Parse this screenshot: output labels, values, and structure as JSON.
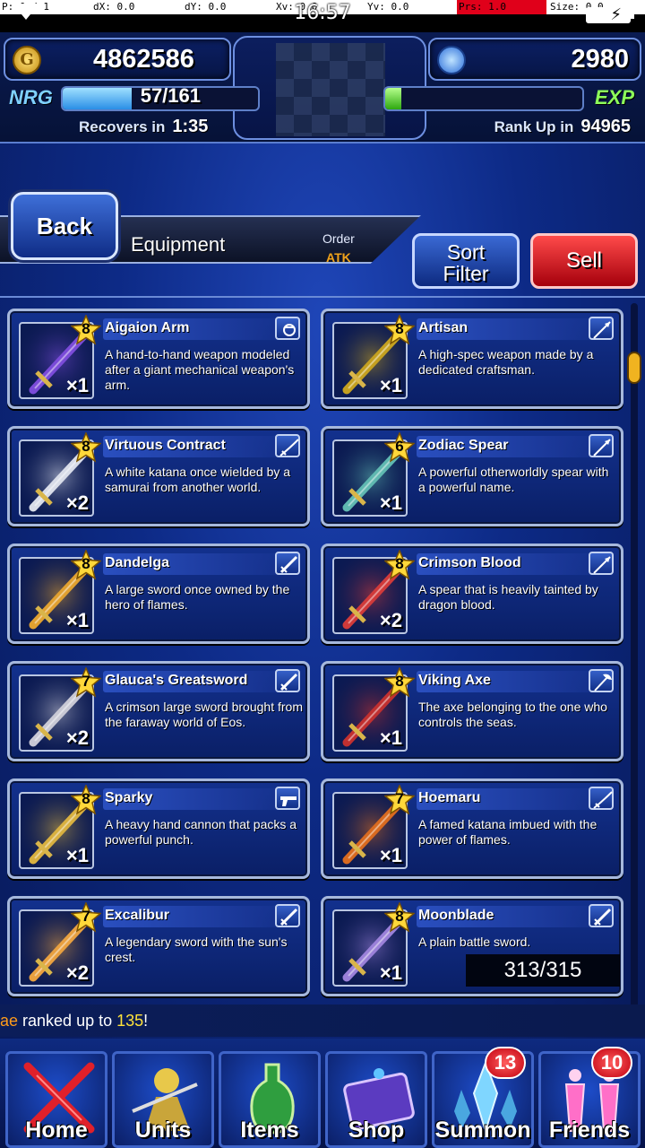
{
  "debug": {
    "p": "P: 0 / 1",
    "dx": "dX: 0.0",
    "dy": "dY: 0.0",
    "xv": "Xv: 0.0",
    "yv": "Yv: 0.0",
    "prs": "Prs: 1.0",
    "size": "Size: 0.0"
  },
  "status": {
    "time": "16:57",
    "battery_level": 1.0
  },
  "hud": {
    "gil": "4862586",
    "gems": "2980",
    "nrg_label": "NRG",
    "nrg_value": "57/161",
    "nrg_current": 57,
    "nrg_max": 161,
    "recovers_label": "Recovers in",
    "recovers_time": "1:35",
    "exp_label": "EXP",
    "exp_fraction": 0.08,
    "rank_label": "Rank Up in",
    "rank_value": "94965"
  },
  "header": {
    "back": "Back",
    "title": "Equipment",
    "order_label": "Order",
    "order_value": "ATK",
    "sort_line1": "Sort",
    "sort_line2": "Filter",
    "sell": "Sell"
  },
  "items": [
    {
      "name": "Aigaion Arm",
      "rarity": "8",
      "qty": "×1",
      "desc": "A hand-to-hand weapon modeled after a giant mechanical weapon's arm.",
      "type_icon": "fist-icon",
      "color": "#7a4bd8"
    },
    {
      "name": "Artisan",
      "rarity": "8",
      "qty": "×1",
      "desc": "A high-spec weapon made by a dedicated craftsman.",
      "type_icon": "spear-icon",
      "color": "#c4a020"
    },
    {
      "name": "Virtuous Contract",
      "rarity": "8",
      "qty": "×2",
      "desc": "A white katana once wielded by a samurai from another world.",
      "type_icon": "katana-icon",
      "color": "#d8dce8"
    },
    {
      "name": "Zodiac Spear",
      "rarity": "6",
      "qty": "×1",
      "desc": "A powerful otherworldly spear with a powerful name.",
      "type_icon": "spear-icon",
      "color": "#5fb8b0"
    },
    {
      "name": "Dandelga",
      "rarity": "8",
      "qty": "×1",
      "desc": "A large sword once owned by the hero of flames.",
      "type_icon": "sword-icon",
      "color": "#e0a030"
    },
    {
      "name": "Crimson Blood",
      "rarity": "8",
      "qty": "×2",
      "desc": "A spear that is heavily tainted by dragon blood.",
      "type_icon": "spear-icon",
      "color": "#d03a3a"
    },
    {
      "name": "Glauca's Greatsword",
      "rarity": "7",
      "qty": "×2",
      "desc": "A crimson large sword brought from the faraway world of Eos.",
      "type_icon": "sword-icon",
      "color": "#c8c8d4"
    },
    {
      "name": "Viking Axe",
      "rarity": "8",
      "qty": "×1",
      "desc": "The axe belonging to the one who controls the seas.",
      "type_icon": "axe-icon",
      "color": "#c03030"
    },
    {
      "name": "Sparky",
      "rarity": "8",
      "qty": "×1",
      "desc": "A heavy hand cannon that packs a powerful punch.",
      "type_icon": "gun-icon",
      "color": "#d8b040"
    },
    {
      "name": "Hoemaru",
      "rarity": "7",
      "qty": "×1",
      "desc": "A famed katana imbued with the power of flames.",
      "type_icon": "katana-icon",
      "color": "#d86a20"
    },
    {
      "name": "Excalibur",
      "rarity": "7",
      "qty": "×2",
      "desc": "A legendary sword with the sun's crest.",
      "type_icon": "sword-icon",
      "color": "#e8a040"
    },
    {
      "name": "Moonblade",
      "rarity": "8",
      "qty": "×1",
      "desc": "A plain battle sword.",
      "type_icon": "sword-icon",
      "color": "#9a80d8"
    }
  ],
  "capacity": "313/315",
  "ticker": {
    "name_fragment": "ae",
    "text": " ranked up to ",
    "value": "135",
    "suffix": "!"
  },
  "nav": [
    {
      "label": "Home",
      "icon": "home-icon",
      "badge": ""
    },
    {
      "label": "Units",
      "icon": "units-icon",
      "badge": ""
    },
    {
      "label": "Items",
      "icon": "items-icon",
      "badge": ""
    },
    {
      "label": "Shop",
      "icon": "shop-icon",
      "badge": ""
    },
    {
      "label": "Summon",
      "icon": "summon-icon",
      "badge": "13"
    },
    {
      "label": "Friends",
      "icon": "friends-icon",
      "badge": "10"
    }
  ]
}
